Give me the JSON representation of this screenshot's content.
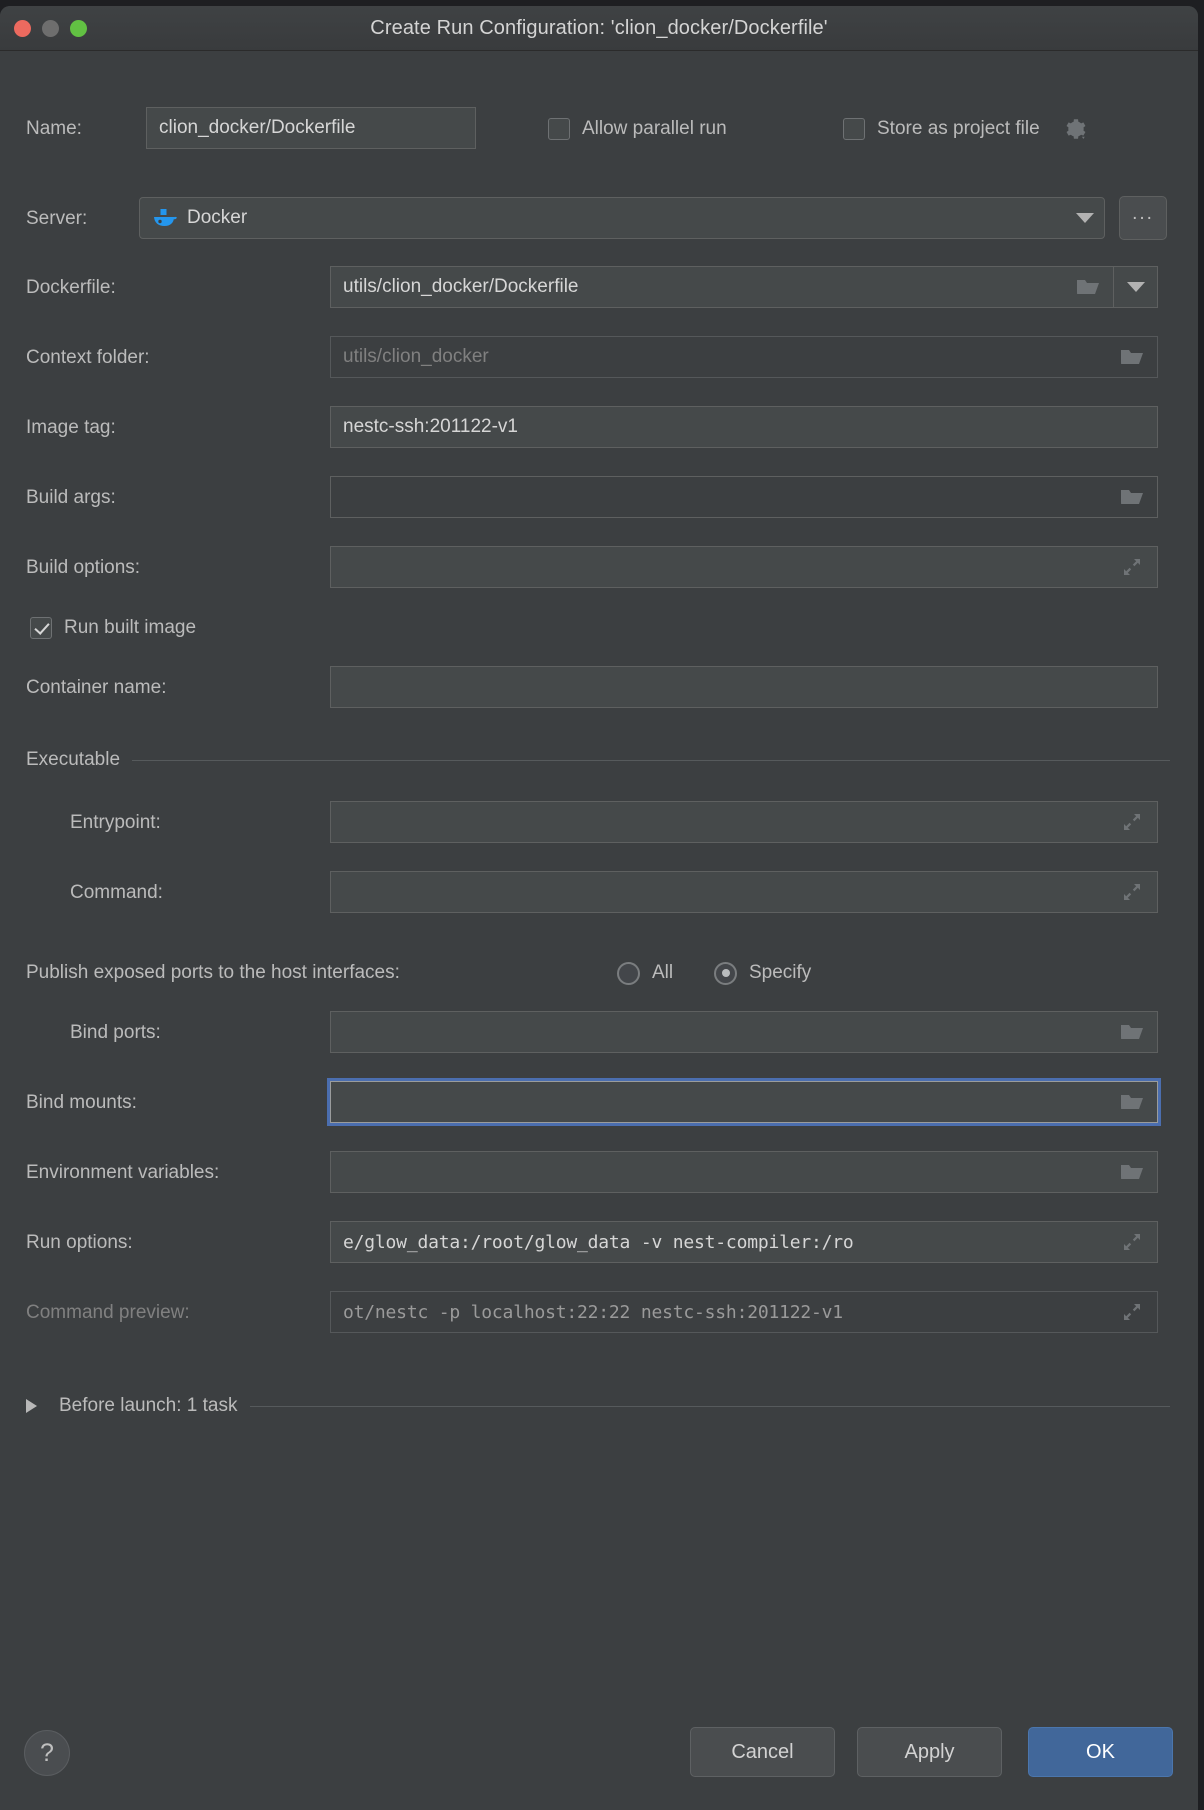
{
  "window": {
    "title": "Create Run Configuration: 'clion_docker/Dockerfile'",
    "traffic_lights": {
      "close": "close-button",
      "minimize": "minimize-button",
      "zoom": "zoom-button"
    },
    "colors": {
      "background": "#3c3f41",
      "field_background": "#45494a",
      "accent_blue": "#4b6eaf",
      "primary_button": "#41679a",
      "docker_blue": "#2496ED",
      "text": "#bbbbbb",
      "dim_text": "#808080"
    }
  },
  "form": {
    "name": {
      "label": "Name:",
      "value": "clion_docker/Dockerfile",
      "placeholder": ""
    },
    "allow_parallel_run": {
      "label": "Allow parallel run",
      "checked": false
    },
    "store_as_project_file": {
      "label": "Store as project file",
      "checked": false,
      "gear_icon": "gear-icon"
    },
    "server": {
      "label": "Server:",
      "value": "Docker",
      "icon": "docker-whale-icon",
      "browse_label": "..."
    },
    "dockerfile": {
      "label": "Dockerfile:",
      "value": "utils/clion_docker/Dockerfile",
      "icon": "folder-icon"
    },
    "context_folder": {
      "label": "Context folder:",
      "value": "utils/clion_docker",
      "is_placeholder": true,
      "icon": "folder-icon"
    },
    "image_tag": {
      "label": "Image tag:",
      "value": "nestc-ssh:201122-v1"
    },
    "build_args": {
      "label": "Build args:",
      "value": "",
      "icon": "folder-icon"
    },
    "build_options": {
      "label": "Build options:",
      "value": "",
      "icon": "expand-icon"
    },
    "run_built_image": {
      "label": "Run built image",
      "checked": true
    },
    "container_name": {
      "label": "Container name:",
      "value": ""
    },
    "executable_group": {
      "label": "Executable"
    },
    "entrypoint": {
      "label": "Entrypoint:",
      "value": "",
      "icon": "expand-icon"
    },
    "command": {
      "label": "Command:",
      "value": "",
      "icon": "expand-icon"
    },
    "publish_ports": {
      "label": "Publish exposed ports to the host interfaces:",
      "options": [
        "All",
        "Specify"
      ],
      "selected": "Specify"
    },
    "bind_ports": {
      "label": "Bind ports:",
      "value": "",
      "icon": "folder-icon"
    },
    "bind_mounts": {
      "label": "Bind mounts:",
      "value": "",
      "icon": "folder-icon",
      "focused": true
    },
    "environment_variables": {
      "label": "Environment variables:",
      "value": "",
      "icon": "folder-icon"
    },
    "run_options": {
      "label": "Run options:",
      "value": "e/glow_data:/root/glow_data -v nest-compiler:/ro",
      "icon": "expand-icon"
    },
    "command_preview": {
      "label": "Command preview:",
      "value": "ot/nestc -p localhost:22:22 nestc-ssh:201122-v1",
      "icon": "expand-icon",
      "disabled": true
    },
    "before_launch": {
      "label": "Before launch: 1 task",
      "expanded": false,
      "chevron": "triangle-right-icon"
    }
  },
  "footer": {
    "help_label": "?",
    "cancel_label": "Cancel",
    "apply_label": "Apply",
    "ok_label": "OK"
  }
}
